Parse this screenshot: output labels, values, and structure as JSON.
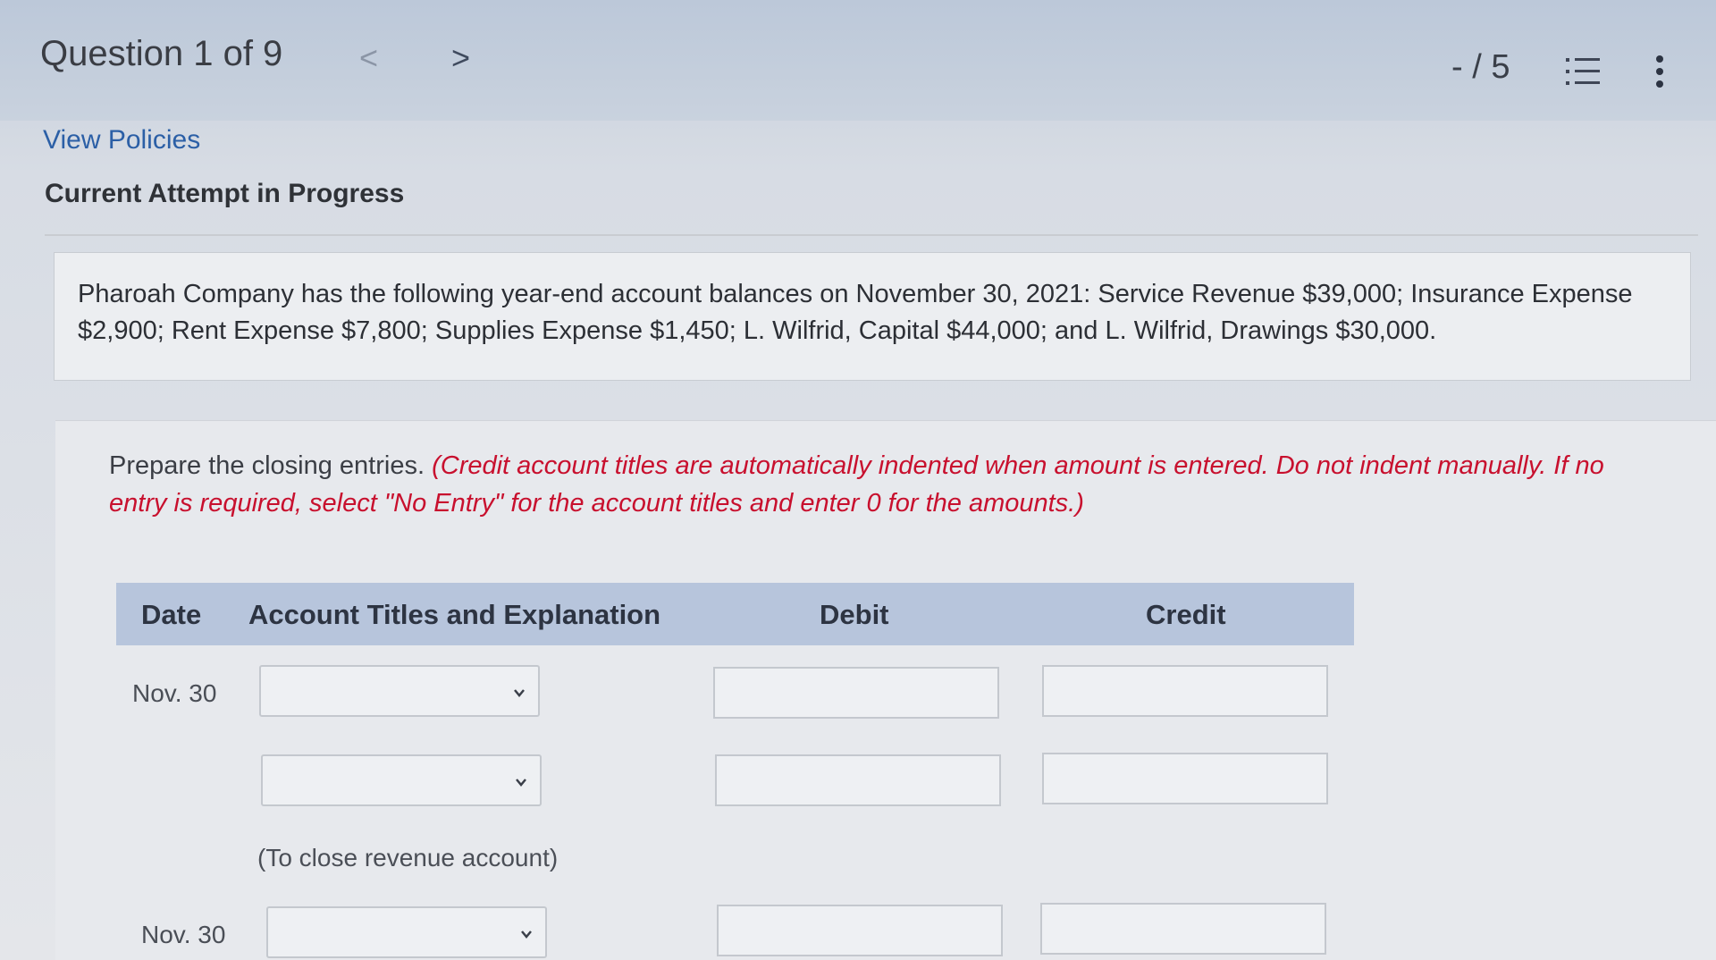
{
  "header": {
    "question_label": "Question 1 of 9",
    "prev_glyph": "<",
    "next_glyph": ">",
    "score": "- / 5"
  },
  "links": {
    "view_policies": "View Policies"
  },
  "status": {
    "attempt": "Current Attempt in Progress"
  },
  "problem": {
    "text": "Pharoah Company has the following year-end account balances on November 30, 2021: Service Revenue $39,000; Insurance Expense $2,900; Rent Expense $7,800; Supplies Expense $1,450; L. Wilfrid, Capital $44,000; and L. Wilfrid, Drawings $30,000."
  },
  "instructions": {
    "lead": "Prepare the closing entries.",
    "note": "(Credit account titles are automatically indented when amount is entered. Do not indent manually. If no entry is required, select \"No Entry\" for the account titles and enter 0 for the amounts.)"
  },
  "table": {
    "headers": {
      "date": "Date",
      "account": "Account Titles and Explanation",
      "debit": "Debit",
      "credit": "Credit"
    },
    "entries": [
      {
        "date": "Nov. 30",
        "note": "(To close revenue account)"
      },
      {
        "date": "Nov. 30"
      }
    ]
  },
  "icons": {
    "list": "list-icon",
    "more": "more-vertical-icon",
    "chevron": "chevron-down-icon"
  },
  "colors": {
    "link": "#2b5fa6",
    "instruction_red": "#c8102e",
    "table_header": "#b7c5dc"
  }
}
